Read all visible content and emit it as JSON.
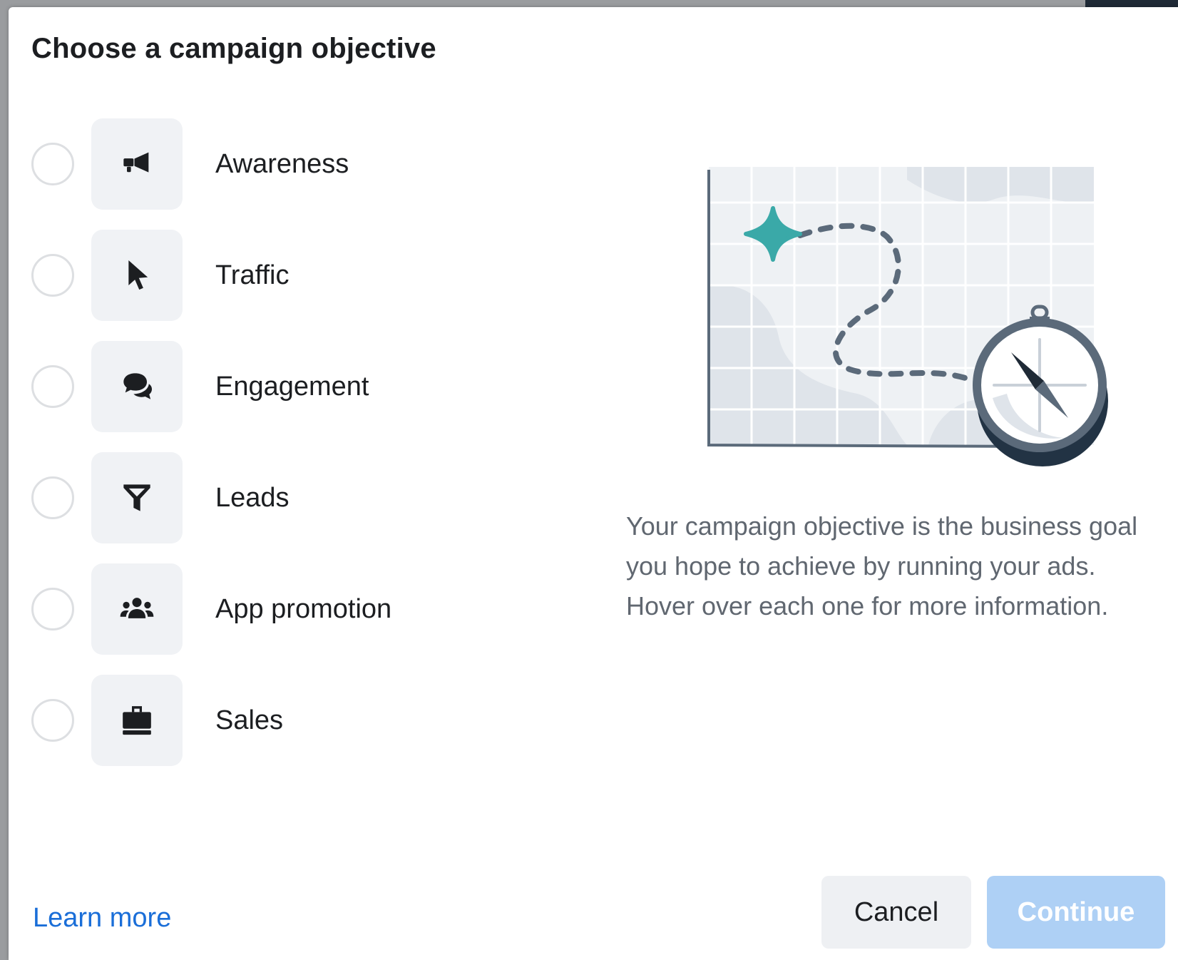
{
  "dialog": {
    "title": "Choose a campaign objective"
  },
  "objectives": [
    {
      "label": "Awareness",
      "icon": "megaphone-icon"
    },
    {
      "label": "Traffic",
      "icon": "cursor-icon"
    },
    {
      "label": "Engagement",
      "icon": "chat-bubbles-icon"
    },
    {
      "label": "Leads",
      "icon": "funnel-icon"
    },
    {
      "label": "App promotion",
      "icon": "people-group-icon"
    },
    {
      "label": "Sales",
      "icon": "briefcase-icon"
    }
  ],
  "illustration": {
    "icon": "map-compass-illustration"
  },
  "description": "Your campaign objective is the business goal you hope to achieve by running your ads. Hover over each one for more information.",
  "footer": {
    "learn_more": "Learn more",
    "cancel": "Cancel",
    "continue": "Continue"
  },
  "colors": {
    "link": "#1a6ed8",
    "continue_disabled": "#aed0f5",
    "accent_teal": "#3aa9a8"
  }
}
